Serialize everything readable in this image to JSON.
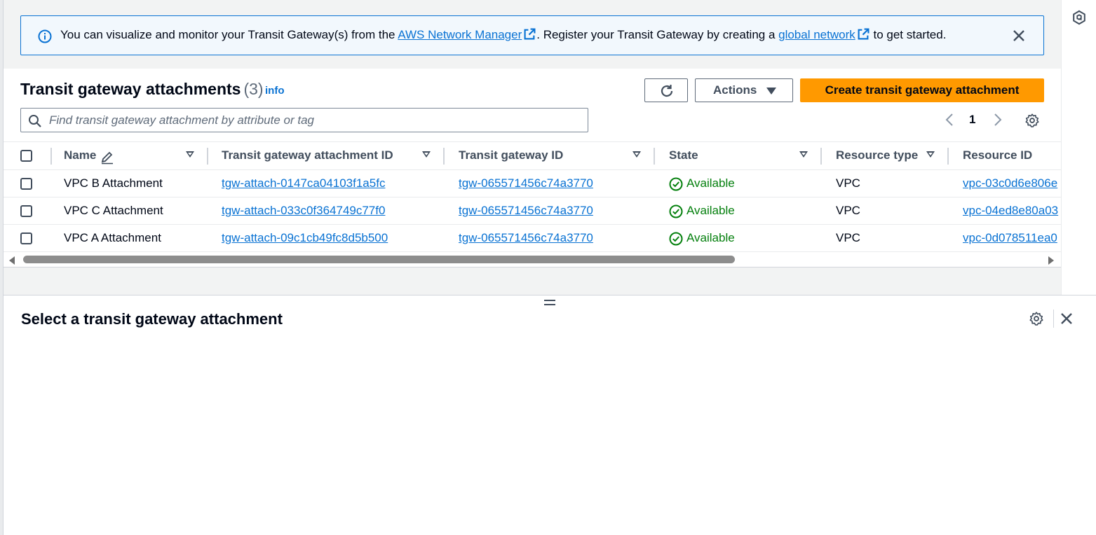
{
  "flash": {
    "text_before": "You can visualize and monitor your Transit Gateway(s) from the ",
    "link1": "AWS Network Manager",
    "text_middle": ". Register your Transit Gateway by creating a ",
    "link2": "global network",
    "text_after": " to get started."
  },
  "table": {
    "title": "Transit gateway attachments",
    "count": "(3)",
    "info": "info",
    "actions_label": "Actions",
    "create_label": "Create transit gateway attachment",
    "search_placeholder": "Find transit gateway attachment by attribute or tag",
    "page": "1",
    "columns": [
      "Name",
      "Transit gateway attachment ID",
      "Transit gateway ID",
      "State",
      "Resource type",
      "Resource ID"
    ],
    "rows": [
      {
        "name": "VPC B Attachment",
        "attachment_id": "tgw-attach-0147ca04103f1a5fc",
        "tgw_id": "tgw-065571456c74a3770",
        "state": "Available",
        "resource_type": "VPC",
        "resource_id": "vpc-03c0d6e806e"
      },
      {
        "name": "VPC C Attachment",
        "attachment_id": "tgw-attach-033c0f364749c77f0",
        "tgw_id": "tgw-065571456c74a3770",
        "state": "Available",
        "resource_type": "VPC",
        "resource_id": "vpc-04ed8e80a03"
      },
      {
        "name": "VPC A Attachment",
        "attachment_id": "tgw-attach-09c1cb49fc8d5b500",
        "tgw_id": "tgw-065571456c74a3770",
        "state": "Available",
        "resource_type": "VPC",
        "resource_id": "vpc-0d078511ea0"
      }
    ]
  },
  "split_panel": {
    "title": "Select a transit gateway attachment"
  },
  "colors": {
    "primary_button": "#ff9900",
    "link": "#0972d3",
    "success": "#037f0c",
    "info_border": "#0972d3"
  }
}
